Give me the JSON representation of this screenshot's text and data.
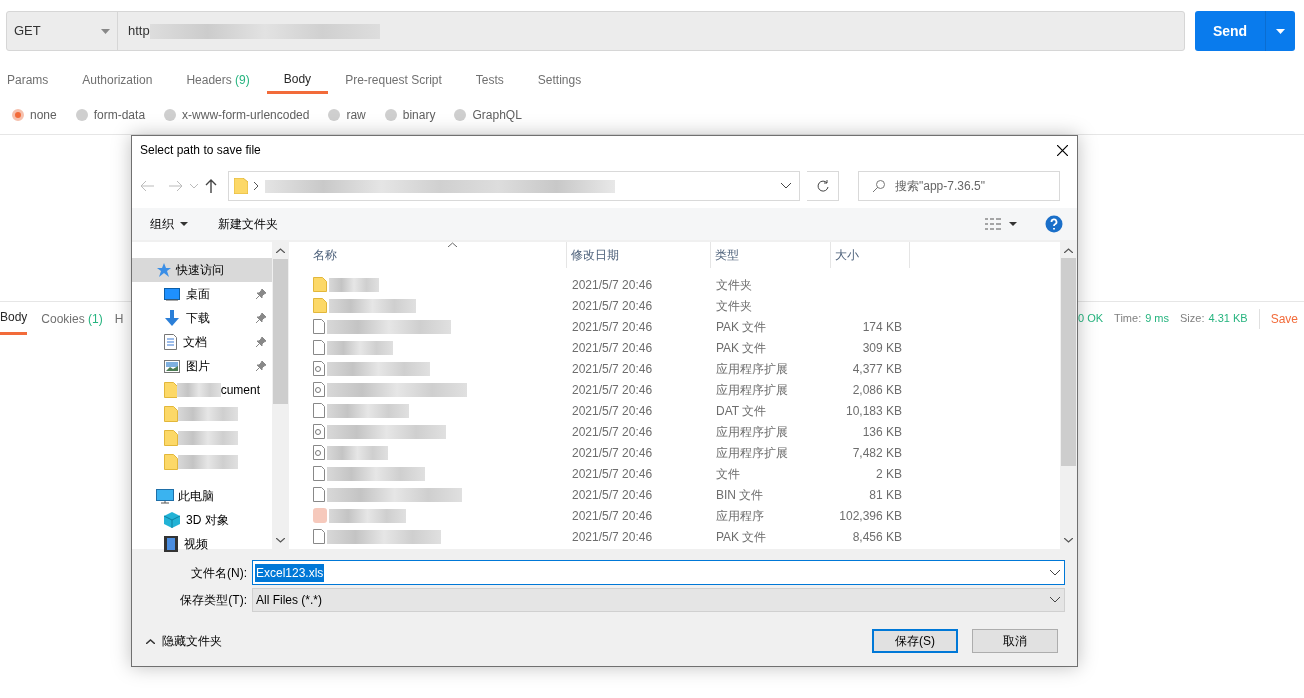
{
  "request": {
    "method": "GET",
    "url": "http",
    "send": "Send"
  },
  "request_tabs": [
    {
      "label": "Params",
      "selected": false
    },
    {
      "label": "Authorization",
      "selected": false
    },
    {
      "label": "Headers",
      "count": "(9)",
      "selected": false
    },
    {
      "label": "Body",
      "selected": true
    },
    {
      "label": "Pre-request Script",
      "selected": false
    },
    {
      "label": "Tests",
      "selected": false
    },
    {
      "label": "Settings",
      "selected": false
    }
  ],
  "body_types": [
    {
      "label": "none",
      "selected": true
    },
    {
      "label": "form-data",
      "selected": false
    },
    {
      "label": "x-www-form-urlencoded",
      "selected": false
    },
    {
      "label": "raw",
      "selected": false
    },
    {
      "label": "binary",
      "selected": false
    },
    {
      "label": "GraphQL",
      "selected": false
    }
  ],
  "response_tabs": [
    {
      "label": "Body",
      "selected": true
    },
    {
      "label": "Cookies",
      "count": "(1)",
      "selected": false
    },
    {
      "label": "H",
      "selected": false
    }
  ],
  "response_meta": {
    "status": "0 OK",
    "time_label": "Time:",
    "time": "9 ms",
    "size_label": "Size:",
    "size": "4.31 KB",
    "save": "Save"
  },
  "dialog": {
    "title": "Select path to save file",
    "search_placeholder": "搜索\"app-7.36.5\"",
    "toolbar": [
      "组织",
      "新建文件夹"
    ],
    "nav": [
      {
        "kind": "star",
        "label": "快速访问",
        "selected": true,
        "children": [
          {
            "kind": "desktop",
            "label": "桌面",
            "pinned": true
          },
          {
            "kind": "download",
            "label": "下载",
            "pinned": true
          },
          {
            "kind": "document",
            "label": "文档",
            "pinned": true
          },
          {
            "kind": "picture",
            "label": "图片",
            "pinned": true
          },
          {
            "kind": "folder",
            "label": "cument"
          },
          {
            "kind": "folder"
          },
          {
            "kind": "folder"
          },
          {
            "kind": "folder"
          }
        ]
      },
      {
        "kind": "pc",
        "label": "此电脑",
        "selected": false,
        "children": [
          {
            "kind": "cube",
            "label": "3D 对象"
          },
          {
            "kind": "video",
            "label": "视频"
          }
        ]
      }
    ],
    "columns": [
      "名称",
      "修改日期",
      "类型",
      "大小"
    ],
    "files": [
      {
        "kind": "folder",
        "modified": "2021/5/7 20:46",
        "type": "文件夹"
      },
      {
        "kind": "folder",
        "modified": "2021/5/7 20:46",
        "type": "文件夹"
      },
      {
        "kind": "file",
        "modified": "2021/5/7 20:46",
        "type": "PAK 文件",
        "size": "174 KB"
      },
      {
        "kind": "file",
        "modified": "2021/5/7 20:46",
        "type": "PAK 文件",
        "size": "309 KB"
      },
      {
        "kind": "extension",
        "modified": "2021/5/7 20:46",
        "type": "应用程序扩展",
        "size": "4,377 KB"
      },
      {
        "kind": "extension",
        "modified": "2021/5/7 20:46",
        "type": "应用程序扩展",
        "size": "2,086 KB"
      },
      {
        "kind": "file",
        "modified": "2021/5/7 20:46",
        "type": "DAT 文件",
        "size": "10,183 KB"
      },
      {
        "kind": "extension",
        "modified": "2021/5/7 20:46",
        "type": "应用程序扩展",
        "size": "136 KB"
      },
      {
        "kind": "extension",
        "modified": "2021/5/7 20:46",
        "type": "应用程序扩展",
        "size": "7,482 KB"
      },
      {
        "kind": "file",
        "modified": "2021/5/7 20:46",
        "type": "文件",
        "size": "2 KB"
      },
      {
        "kind": "file",
        "modified": "2021/5/7 20:46",
        "type": "BIN 文件",
        "size": "81 KB"
      },
      {
        "kind": "app",
        "modified": "2021/5/7 20:46",
        "type": "应用程序",
        "size": "102,396 KB"
      },
      {
        "kind": "file",
        "modified": "2021/5/7 20:46",
        "type": "PAK 文件",
        "size": "8,456 KB"
      }
    ],
    "filename_label": "文件名(N):",
    "filename": "Excel123.xls",
    "filetype_label": "保存类型(T):",
    "filetype": "All Files (*.*)",
    "hide_folders": "隐藏文件夹",
    "save": "保存(S)",
    "cancel": "取消"
  }
}
